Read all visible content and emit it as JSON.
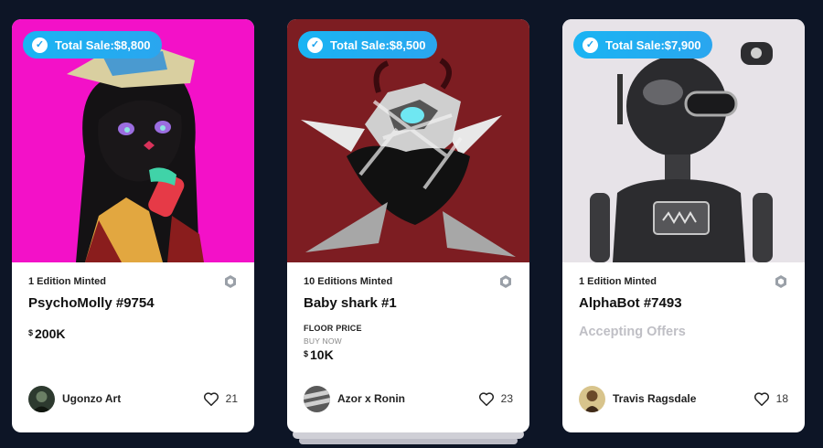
{
  "cards": [
    {
      "total_sale": "Total Sale:$8,800",
      "editions": "1 Edition Minted",
      "title": "PsychoMolly #9754",
      "currency": "$",
      "price": "200K",
      "creator": "Ugonzo Art",
      "likes": "21",
      "art_colors": {
        "background": "#f311c8"
      }
    },
    {
      "total_sale": "Total Sale:$8,500",
      "editions": "10 Editions Minted",
      "title": "Baby shark #1",
      "floor_label": "FLOOR PRICE",
      "buy_now_label": "BUY NOW",
      "currency": "$",
      "price": "10K",
      "creator": "Azor x Ronin",
      "likes": "23",
      "art_colors": {
        "background": "#7d1d22"
      }
    },
    {
      "total_sale": "Total Sale:$7,900",
      "editions": "1 Edition Minted",
      "title": "AlphaBot #7493",
      "status": "Accepting Offers",
      "creator": "Travis Ragsdale",
      "likes": "18",
      "art_colors": {
        "background": "#e7e3e8"
      }
    }
  ],
  "icons": {
    "verified": "check-badge-icon",
    "chain": "hexagon-chain-icon",
    "like": "heart-outline-icon"
  },
  "colors": {
    "page_background": "#0d1526",
    "badge": "#1ab4f3",
    "muted_text": "#bfbfc5"
  }
}
